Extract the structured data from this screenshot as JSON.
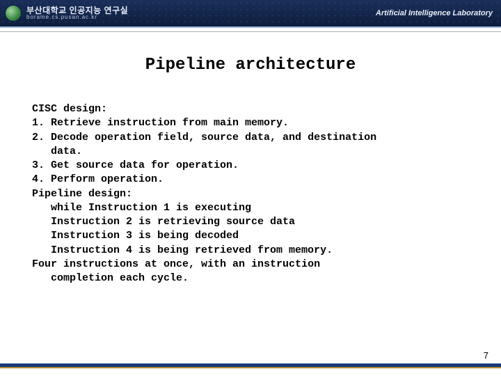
{
  "header": {
    "org_korean": "부산대학교 인공지능 연구실",
    "url": "borame.cs.pusan.ac.kr",
    "lab_label": "Artificial Intelligence Laboratory"
  },
  "slide": {
    "title": "Pipeline architecture"
  },
  "body": {
    "cisc_heading": "CISC design:",
    "step1": "1. Retrieve instruction from main memory.",
    "step2a": "2. Decode operation field, source data, and destination",
    "step2b": "data.",
    "step3": "3. Get source data for operation.",
    "step4": "4. Perform operation.",
    "pipeline_heading": "Pipeline design:",
    "p1": "while Instruction 1 is executing",
    "p2": "Instruction 2 is retrieving source data",
    "p3": "Instruction 3 is being decoded",
    "p4": "Instruction 4 is being retrieved from memory.",
    "closing_a": "Four instructions at once, with an instruction",
    "closing_b": "completion each cycle."
  },
  "page_number": "7"
}
